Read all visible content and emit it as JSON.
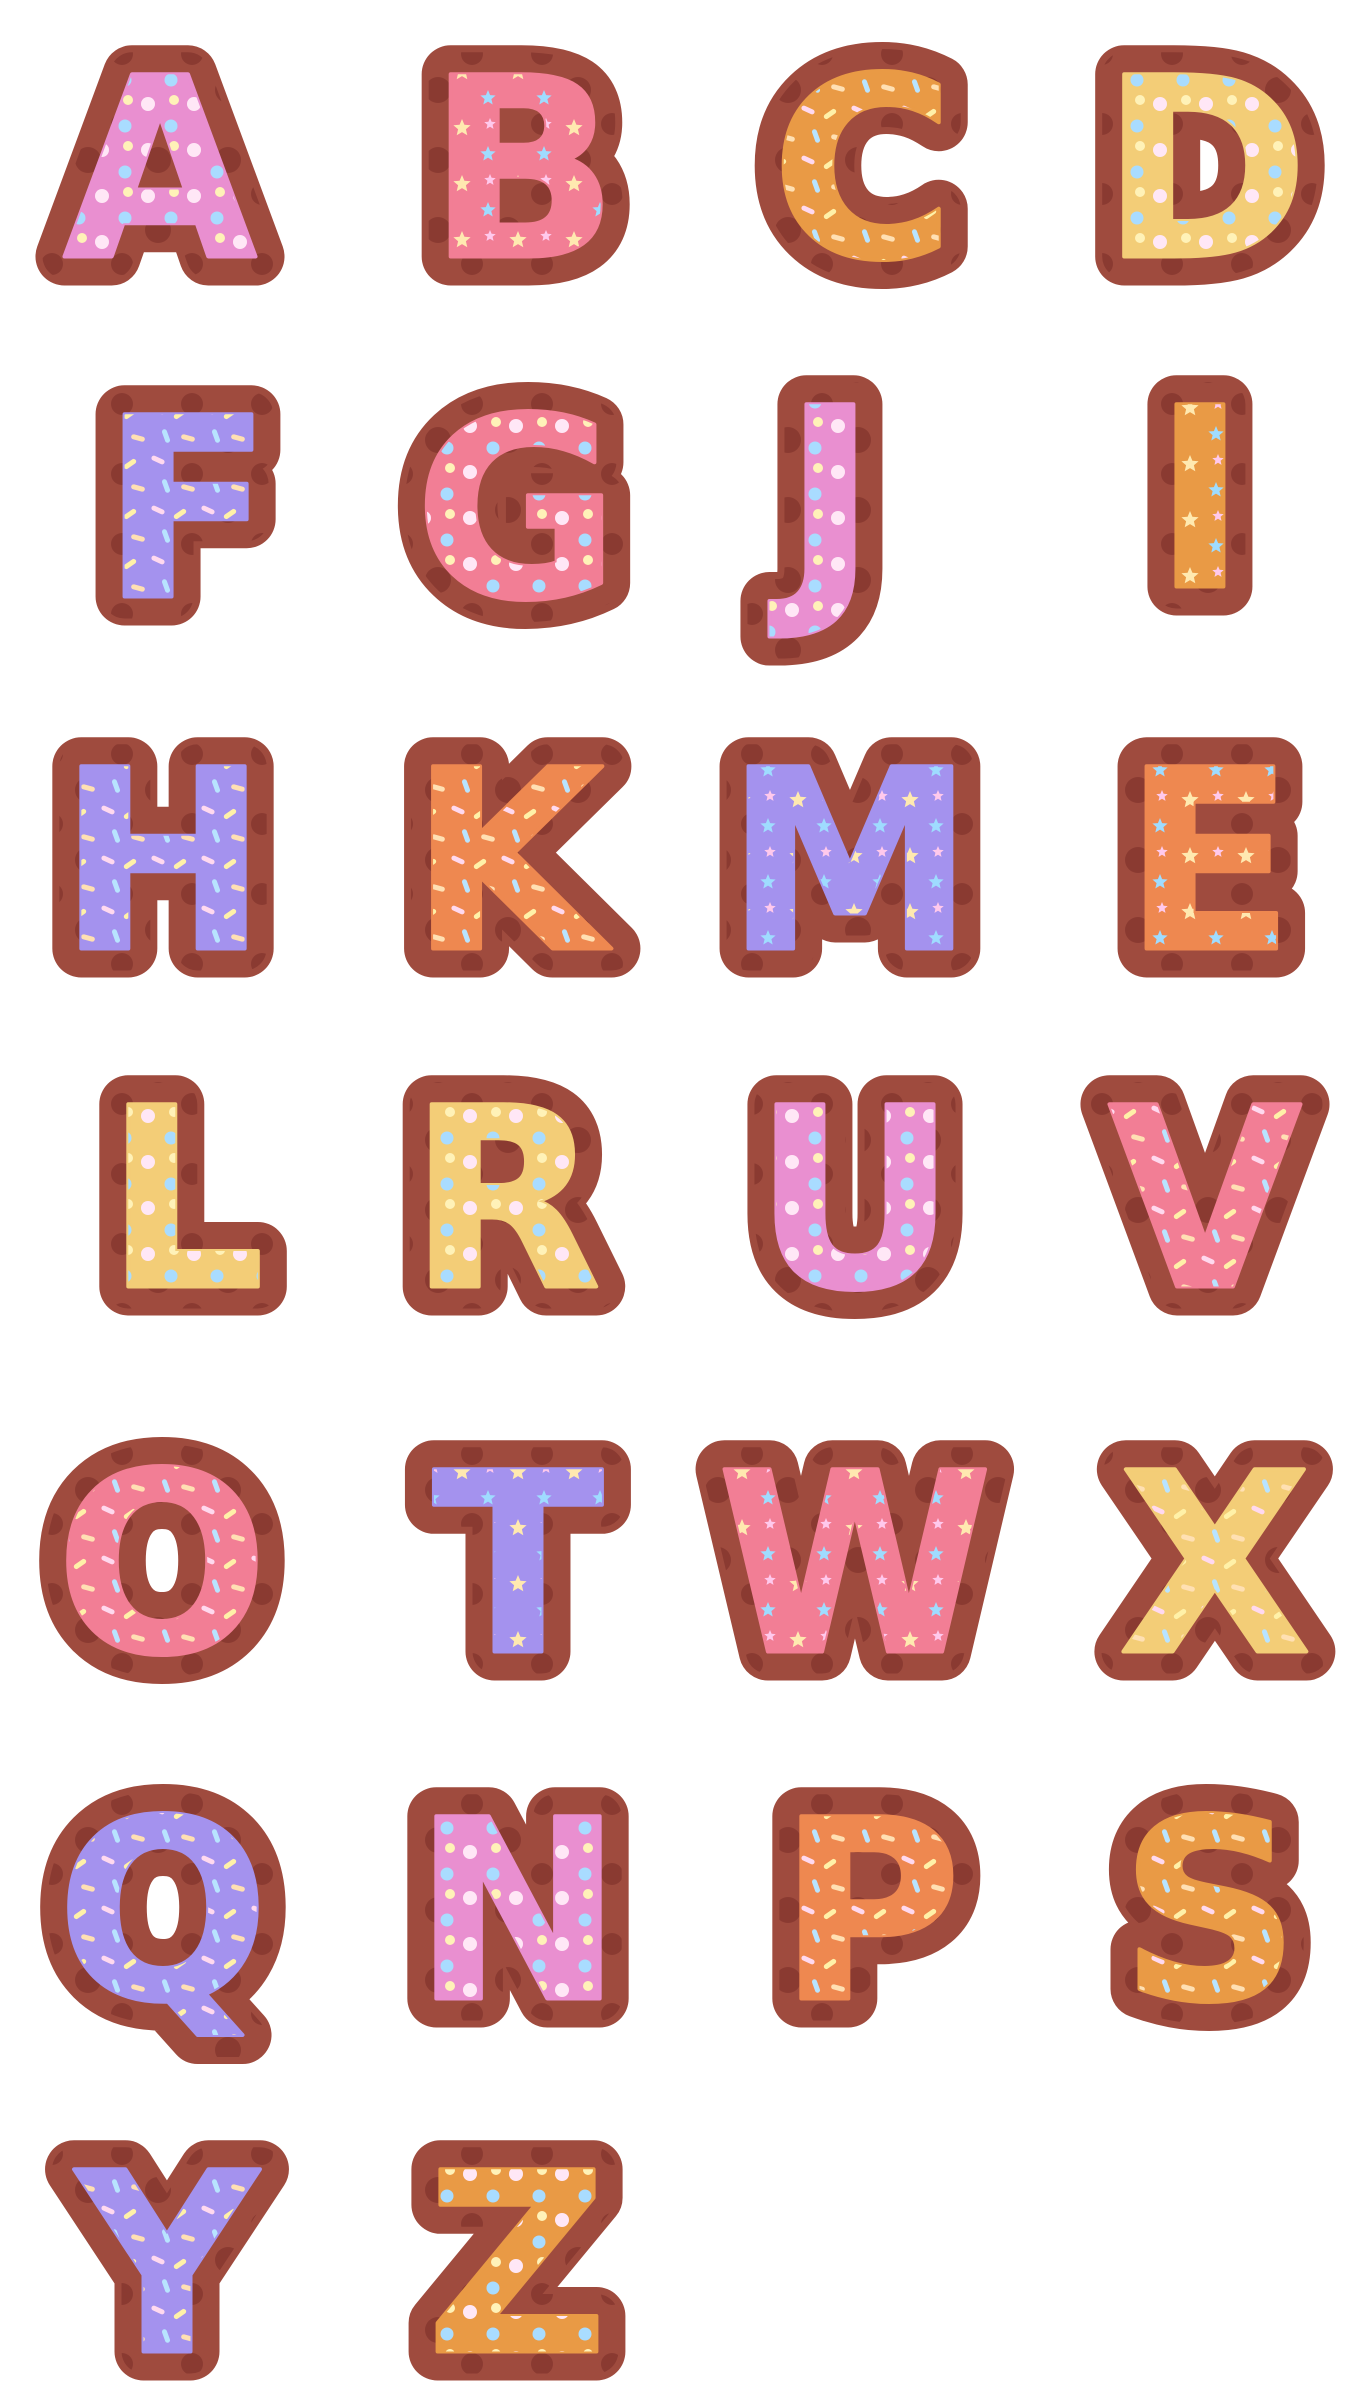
{
  "colors": {
    "background": "#ffffff",
    "cookie": "#9f4b3e",
    "cookie_spot": "#8a3a31",
    "pink": "#e98fd0",
    "rose": "#f27e95",
    "orange": "#e99a45",
    "yellow": "#f3cd77",
    "purple": "#a492ee",
    "coral": "#ee8850"
  },
  "letters": [
    {
      "char": "A",
      "icing": "pink",
      "topping": "dots"
    },
    {
      "char": "B",
      "icing": "rose",
      "topping": "stars"
    },
    {
      "char": "C",
      "icing": "orange",
      "topping": "sprinkles"
    },
    {
      "char": "D",
      "icing": "yellow",
      "topping": "dots"
    },
    {
      "char": "F",
      "icing": "purple",
      "topping": "sprinkles"
    },
    {
      "char": "G",
      "icing": "rose",
      "topping": "dots"
    },
    {
      "char": "J",
      "icing": "pink",
      "topping": "dots"
    },
    {
      "char": "I",
      "icing": "orange",
      "topping": "stars"
    },
    {
      "char": "H",
      "icing": "purple",
      "topping": "sprinkles"
    },
    {
      "char": "K",
      "icing": "coral",
      "topping": "sprinkles"
    },
    {
      "char": "M",
      "icing": "purple",
      "topping": "stars"
    },
    {
      "char": "E",
      "icing": "coral",
      "topping": "stars"
    },
    {
      "char": "L",
      "icing": "yellow",
      "topping": "dots"
    },
    {
      "char": "R",
      "icing": "yellow",
      "topping": "dots"
    },
    {
      "char": "U",
      "icing": "pink",
      "topping": "dots"
    },
    {
      "char": "V",
      "icing": "rose",
      "topping": "sprinkles"
    },
    {
      "char": "O",
      "icing": "rose",
      "topping": "sprinkles"
    },
    {
      "char": "T",
      "icing": "purple",
      "topping": "stars"
    },
    {
      "char": "W",
      "icing": "rose",
      "topping": "stars"
    },
    {
      "char": "X",
      "icing": "yellow",
      "topping": "sprinkles"
    },
    {
      "char": "Q",
      "icing": "purple",
      "topping": "sprinkles"
    },
    {
      "char": "N",
      "icing": "pink",
      "topping": "dots"
    },
    {
      "char": "P",
      "icing": "coral",
      "topping": "sprinkles"
    },
    {
      "char": "S",
      "icing": "orange",
      "topping": "sprinkles"
    },
    {
      "char": "Y",
      "icing": "purple",
      "topping": "sprinkles"
    },
    {
      "char": "Z",
      "icing": "orange",
      "topping": "dots"
    }
  ]
}
